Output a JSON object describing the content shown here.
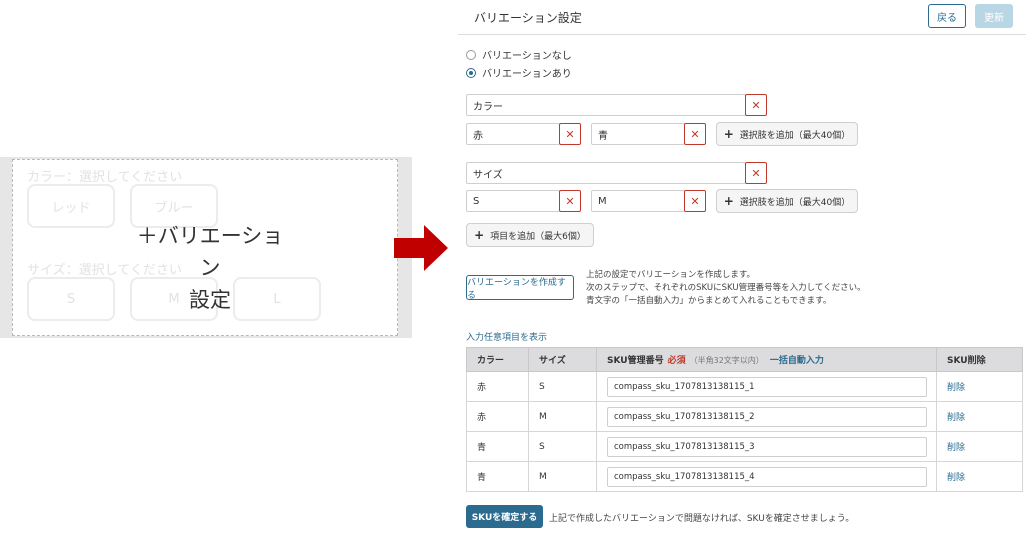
{
  "preview": {
    "color_prompt": "カラー：選択してください",
    "size_prompt": "サイズ：選択してください",
    "color_chips": [
      "レッド",
      "ブルー"
    ],
    "size_chips": [
      "S",
      "M",
      "L"
    ],
    "overlay_line1": "＋バリエーション",
    "overlay_line2": "設定"
  },
  "header": {
    "title": "バリエーション設定",
    "back_label": "戻る",
    "update_label": "更新"
  },
  "variation_mode": {
    "options": [
      "バリエーションなし",
      "バリエーションあり"
    ],
    "selected": "バリエーションあり"
  },
  "attributes": [
    {
      "name": "カラー",
      "values": [
        "赤",
        "青"
      ],
      "add_label": "選択肢を追加（最大40個）"
    },
    {
      "name": "サイズ",
      "values": [
        "S",
        "M"
      ],
      "add_label": "選択肢を追加（最大40個）"
    }
  ],
  "add_item_label": "項目を追加（最大6個）",
  "create_button_label": "バリエーションを作成する",
  "create_note": [
    "上記の設定でバリエーションを作成します。",
    "次のステップで、それぞれのSKUにSKU管理番号等を入力してください。",
    "青文字の「一括自動入力」からまとめて入れることもできます。"
  ],
  "optional_fields_link": "入力任意項目を表示",
  "table": {
    "headers": {
      "color": "カラー",
      "size": "サイズ",
      "sku": "SKU管理番号",
      "required": "必須",
      "hint": "（半角32文字以内）",
      "autofill": "一括自動入力",
      "delete": "SKU削除"
    },
    "rows": [
      {
        "color": "赤",
        "size": "S",
        "sku": "compass_sku_1707813138115_1",
        "delete": "削除"
      },
      {
        "color": "赤",
        "size": "M",
        "sku": "compass_sku_1707813138115_2",
        "delete": "削除"
      },
      {
        "color": "青",
        "size": "S",
        "sku": "compass_sku_1707813138115_3",
        "delete": "削除"
      },
      {
        "color": "青",
        "size": "M",
        "sku": "compass_sku_1707813138115_4",
        "delete": "削除"
      }
    ]
  },
  "confirm_button_label": "SKUを確定する",
  "confirm_note": "上記で作成したバリエーションで問題なければ、SKUを確定させましょう。",
  "icons": {
    "remove": "close-icon",
    "add": "plus-icon",
    "arrow": "right-arrow-icon"
  },
  "colors": {
    "accent": "#2a6b8f",
    "danger": "#c0392b",
    "arrow": "#c00000",
    "update_disabled": "#b9d6e4"
  }
}
